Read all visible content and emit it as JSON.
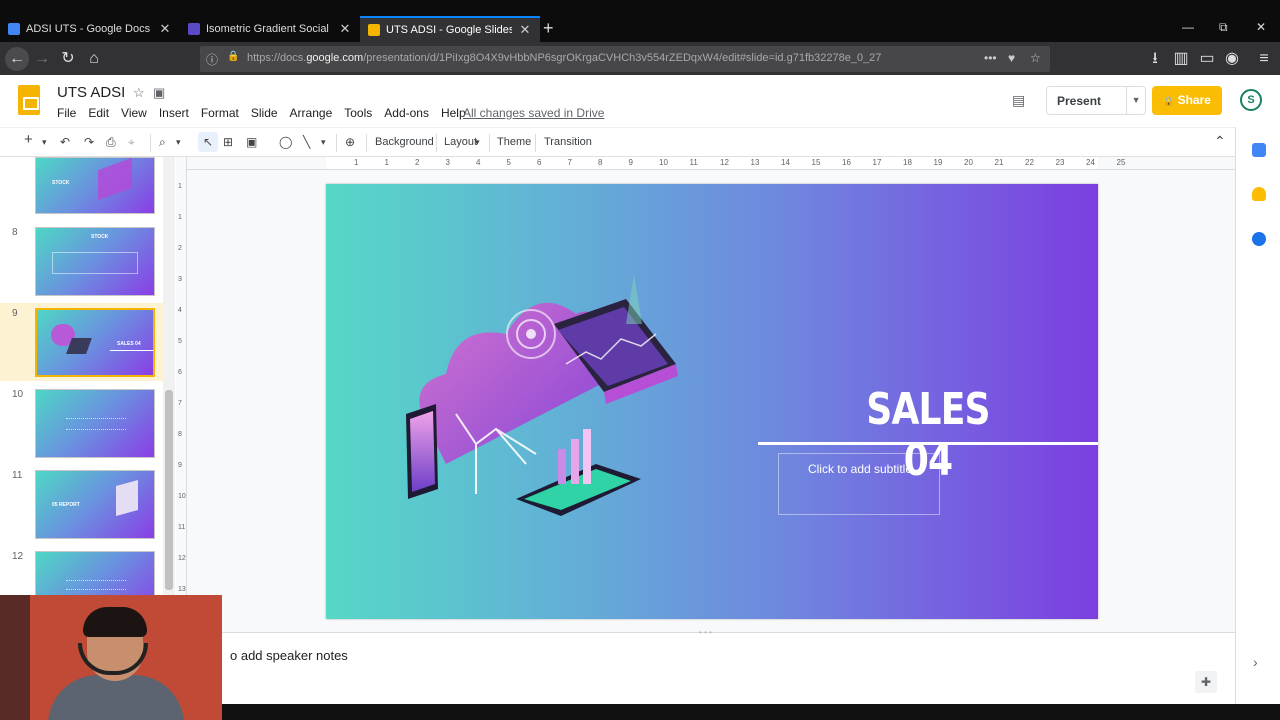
{
  "browser": {
    "tabs": [
      {
        "title": "ADSI UTS - Google Docs",
        "close": "✕",
        "color": "#4285f4",
        "active": false
      },
      {
        "title": "Isometric Gradient Social Media",
        "close": "✕",
        "color": "#5b4ac5",
        "active": false
      },
      {
        "title": "UTS ADSI - Google Slides",
        "close": "✕",
        "color": "#f4b400",
        "active": true
      }
    ],
    "new_tab": "+",
    "window_controls": {
      "minimize": "—",
      "maximize": "⧉",
      "close": "✕"
    },
    "nav": {
      "back": "←",
      "forward": "→",
      "reload": "↻",
      "home": "⌂"
    },
    "url": {
      "prefix": "https://docs.",
      "domain": "google.com",
      "path": "/presentation/d/1PiIxg8O4X9vHbbNP6sgrOKrgaCVHCh3v554rZEDqxW4/edit#slide=id.g71fb32278e_0_27"
    },
    "url_icons": {
      "info": "ⓘ",
      "lock": "🔒",
      "more": "•••",
      "pocket": "♥",
      "star": "☆"
    },
    "right_icons": {
      "download": "⭳",
      "library": "▥",
      "sidebar": "▭",
      "account": "◉",
      "menu": "≡"
    }
  },
  "docs": {
    "title": "UTS ADSI",
    "star_icon": "☆",
    "folder_icon": "▣",
    "menu": [
      "File",
      "Edit",
      "View",
      "Insert",
      "Format",
      "Slide",
      "Arrange",
      "Tools",
      "Add-ons",
      "Help"
    ],
    "save_status": "All changes saved in Drive",
    "comment_icon": "▤",
    "present_label": "Present",
    "present_dropdown": "▼",
    "share_label": "Share",
    "share_icon": "🔒",
    "account_initial": "S"
  },
  "toolbar": {
    "icons": [
      "+",
      "▾",
      "↶",
      "↷",
      "⎙",
      "⌖",
      "⌕",
      "▾",
      "↖",
      "⊞",
      "▣",
      "◯",
      "╲",
      "▾",
      "⊕"
    ],
    "background_label": "Background",
    "layout_label": "Layout",
    "layout_caret": "▾",
    "theme_label": "Theme",
    "transition_label": "Transition",
    "collapse_icon": "⌃"
  },
  "filmstrip": {
    "slides": [
      {
        "number": "",
        "label": "STOCK"
      },
      {
        "number": "8",
        "label": "STOCK"
      },
      {
        "number": "9",
        "label": "SALES 04",
        "active": true
      },
      {
        "number": "10",
        "label": ""
      },
      {
        "number": "11",
        "label": "05 REPORT"
      },
      {
        "number": "12",
        "label": ""
      }
    ]
  },
  "ruler": {
    "h_numbers": [
      "1",
      "1",
      "2",
      "3",
      "4",
      "5",
      "6",
      "7",
      "8",
      "9",
      "10",
      "11",
      "12",
      "13",
      "14",
      "15",
      "16",
      "17",
      "18",
      "19",
      "20",
      "21",
      "22",
      "23",
      "24",
      "25"
    ],
    "v_numbers": [
      "1",
      "1",
      "2",
      "3",
      "4",
      "5",
      "6",
      "7",
      "8",
      "9",
      "10",
      "11",
      "12",
      "13"
    ]
  },
  "slide": {
    "title": "SALES  04",
    "subtitle_placeholder": "Click to add subtitle"
  },
  "notes": {
    "placeholder": "o add speaker notes",
    "handle": "• • •",
    "add_icon": "✚"
  },
  "side_panel": {
    "chevron": "›",
    "icons": [
      {
        "name": "calendar",
        "color": "#4285f4"
      },
      {
        "name": "keep",
        "color": "#fbbc04"
      },
      {
        "name": "tasks",
        "color": "#1a73e8"
      }
    ]
  }
}
